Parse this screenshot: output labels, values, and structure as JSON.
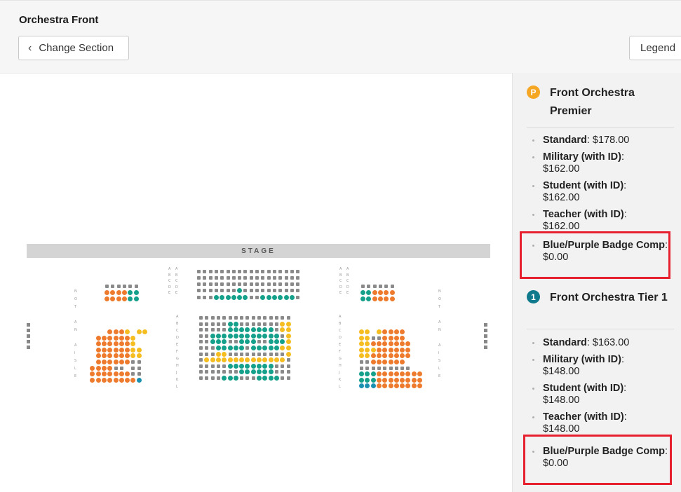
{
  "header": {
    "section_title": "Orchestra Front",
    "change_section_label": "Change Section",
    "legend_label": "Legend"
  },
  "stage_label": "STAGE",
  "colors": {
    "premier": "#f5a623",
    "tier1": "#0f7a8c",
    "orange": "#ee7a2d",
    "yellow": "#f5bd1f",
    "teal": "#14a08a",
    "blue": "#1b8fb0",
    "unavailable": "#8a8a8a",
    "highlight": "#e6202e"
  },
  "aisle_labels": {
    "left": [
      "N",
      "O",
      "T",
      "",
      "A",
      "N",
      "",
      "A",
      "I",
      "S",
      "L",
      "E"
    ],
    "right": [
      "N",
      "O",
      "T",
      "",
      "A",
      "N",
      "",
      "A",
      "I",
      "S",
      "L",
      "E"
    ]
  },
  "tiers": [
    {
      "badge": "P",
      "name": "Front Orchestra Premier",
      "prices": [
        {
          "label": "Standard",
          "value": "$178.00"
        },
        {
          "label": "Military (with ID)",
          "value": "$162.00"
        },
        {
          "label": "Student (with ID)",
          "value": "$162.00"
        },
        {
          "label": "Teacher (with ID)",
          "value": "$162.00"
        },
        {
          "label": "Blue/Purple Badge Comp",
          "value": "$0.00"
        }
      ]
    },
    {
      "badge": "1",
      "name": "Front Orchestra Tier 1",
      "prices": [
        {
          "label": "Standard",
          "value": "$163.00"
        },
        {
          "label": "Military (with ID)",
          "value": "$148.00"
        },
        {
          "label": "Student (with ID)",
          "value": "$148.00"
        },
        {
          "label": "Teacher (with ID)",
          "value": "$148.00"
        },
        {
          "label": "Blue/Purple Badge Comp",
          "value": "$0.00"
        }
      ]
    }
  ]
}
